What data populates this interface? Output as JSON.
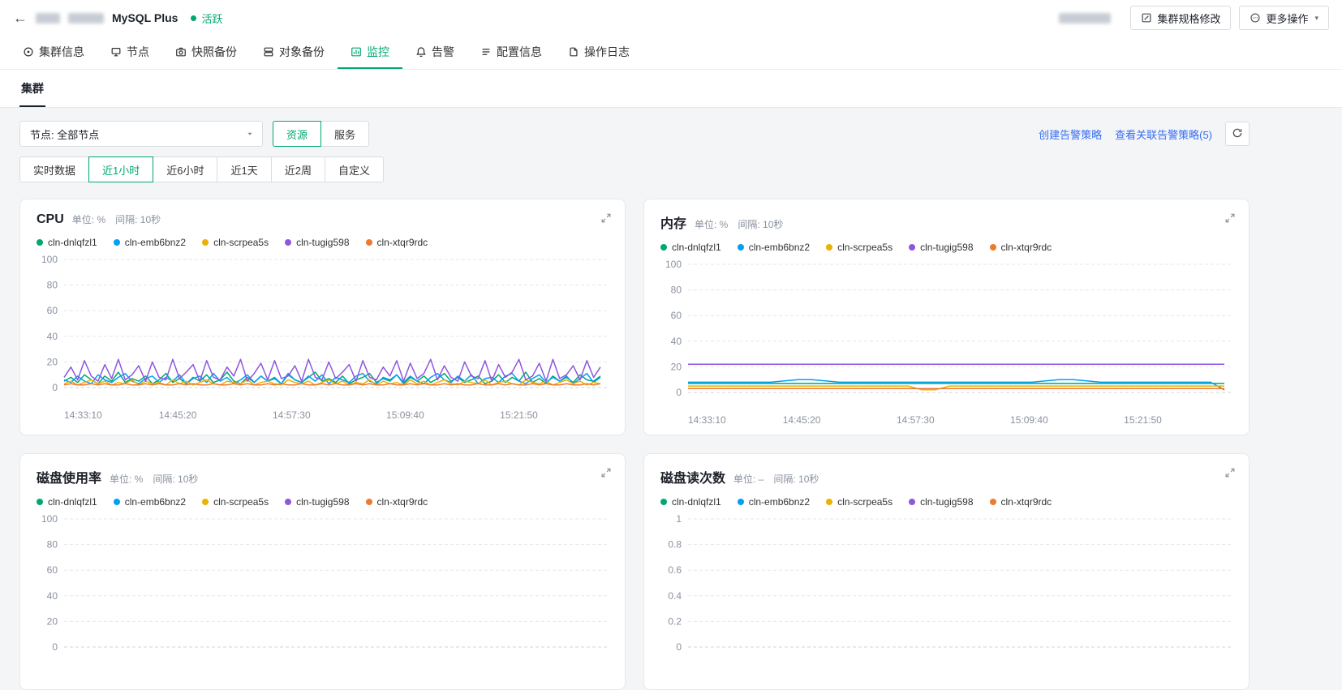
{
  "colors": {
    "accent": "#00a870",
    "link": "#366ef4"
  },
  "header": {
    "back_icon": "←",
    "product_name": "MySQL Plus",
    "status": {
      "label": "活跃",
      "color": "#00a870"
    },
    "actions": {
      "modify_spec": "集群规格修改",
      "more": "更多操作"
    }
  },
  "tabs": [
    {
      "key": "cluster-info",
      "label": "集群信息",
      "icon": "cluster-info-icon",
      "active": false
    },
    {
      "key": "nodes",
      "label": "节点",
      "icon": "node-icon",
      "active": false
    },
    {
      "key": "snapshot-backup",
      "label": "快照备份",
      "icon": "snapshot-icon",
      "active": false
    },
    {
      "key": "object-backup",
      "label": "对象备份",
      "icon": "object-backup-icon",
      "active": false
    },
    {
      "key": "monitoring",
      "label": "监控",
      "icon": "monitor-icon",
      "active": true
    },
    {
      "key": "alerts",
      "label": "告警",
      "icon": "alert-icon",
      "active": false
    },
    {
      "key": "config-info",
      "label": "配置信息",
      "icon": "config-icon",
      "active": false
    },
    {
      "key": "operation-logs",
      "label": "操作日志",
      "icon": "log-icon",
      "active": false
    }
  ],
  "subtab": {
    "label": "集群"
  },
  "filters": {
    "node_select": {
      "value": "节点: 全部节点"
    },
    "category_buttons": [
      {
        "key": "resource",
        "label": "资源",
        "active": true
      },
      {
        "key": "service",
        "label": "服务",
        "active": false
      }
    ],
    "links": [
      {
        "label": "创建告警策略"
      },
      {
        "label": "查看关联告警策略(5)"
      }
    ],
    "time_ranges": [
      {
        "key": "realtime",
        "label": "实时数据",
        "active": false
      },
      {
        "key": "last-1h",
        "label": "近1小时",
        "active": true
      },
      {
        "key": "last-6h",
        "label": "近6小时",
        "active": false
      },
      {
        "key": "last-1d",
        "label": "近1天",
        "active": false
      },
      {
        "key": "last-2w",
        "label": "近2周",
        "active": false
      },
      {
        "key": "custom",
        "label": "自定义",
        "active": false
      }
    ]
  },
  "chart_data": [
    {
      "id": "cpu",
      "type": "line",
      "title": "CPU",
      "unit_label": "单位: %　间隔: 10秒",
      "y_ticks": [
        0,
        20,
        40,
        60,
        80,
        100
      ],
      "x_labels": [
        "14:33:10",
        "14:45:20",
        "14:57:30",
        "15:09:40",
        "15:21:50"
      ],
      "series": [
        {
          "name": "cln-dnlqfzl1",
          "color": "#00a870",
          "values": [
            5,
            8,
            4,
            10,
            6,
            3,
            9,
            5,
            12,
            4,
            7,
            5,
            9,
            3,
            6,
            11,
            4,
            7,
            3,
            8,
            5,
            10,
            4,
            6,
            12,
            5,
            3,
            8,
            4,
            9,
            5,
            7,
            3,
            10,
            6,
            4,
            8,
            12,
            5,
            7,
            4,
            9,
            3,
            6,
            8,
            11,
            4,
            7,
            5,
            10,
            3,
            8,
            5,
            9,
            4,
            7,
            11,
            5,
            8,
            4,
            6,
            9,
            3,
            5,
            10,
            4,
            8,
            5,
            12,
            4,
            7,
            3,
            9,
            5,
            8,
            4,
            10,
            6,
            5,
            9
          ]
        },
        {
          "name": "cln-emb6bnz2",
          "color": "#049ff5",
          "values": [
            6,
            4,
            9,
            5,
            3,
            10,
            6,
            4,
            8,
            11,
            5,
            3,
            7,
            9,
            4,
            8,
            5,
            10,
            3,
            7,
            9,
            4,
            11,
            5,
            8,
            3,
            6,
            10,
            4,
            9,
            5,
            8,
            3,
            11,
            6,
            4,
            9,
            5,
            10,
            3,
            8,
            6,
            4,
            9,
            11,
            5,
            3,
            8,
            6,
            10,
            4,
            9,
            5,
            3,
            8,
            11,
            6,
            4,
            9,
            5,
            10,
            3,
            7,
            8,
            4,
            9,
            11,
            5,
            3,
            7,
            10,
            4,
            8,
            5,
            9,
            3,
            7,
            11,
            4,
            8
          ]
        },
        {
          "name": "cln-scrpea5s",
          "color": "#ebb105",
          "values": [
            3,
            5,
            2,
            4,
            6,
            3,
            5,
            2,
            4,
            3,
            6,
            2,
            5,
            3,
            4,
            2,
            6,
            3,
            5,
            2,
            4,
            6,
            3,
            2,
            5,
            4,
            3,
            6,
            2,
            4,
            5,
            3,
            2,
            6,
            4,
            3,
            5,
            2,
            4,
            6,
            3,
            5,
            2,
            4,
            3,
            6,
            2,
            5,
            3,
            4,
            2,
            6,
            3,
            5,
            2,
            4,
            6,
            3,
            2,
            5,
            4,
            3,
            6,
            2,
            4,
            5,
            3,
            2,
            6,
            4,
            3,
            5,
            2,
            4,
            6,
            3,
            5,
            2,
            4,
            3
          ]
        },
        {
          "name": "cln-tugig598",
          "color": "#8e56dd",
          "values": [
            8,
            16,
            6,
            21,
            9,
            5,
            18,
            7,
            22,
            6,
            10,
            17,
            5,
            20,
            8,
            6,
            22,
            7,
            12,
            18,
            5,
            21,
            8,
            6,
            16,
            9,
            22,
            5,
            11,
            19,
            6,
            21,
            7,
            9,
            17,
            5,
            22,
            8,
            6,
            20,
            7,
            12,
            18,
            5,
            21,
            8,
            6,
            16,
            9,
            21,
            5,
            19,
            7,
            11,
            22,
            6,
            17,
            8,
            5,
            20,
            9,
            7,
            21,
            5,
            18,
            8,
            12,
            22,
            6,
            9,
            19,
            5,
            22,
            7,
            10,
            17,
            6,
            21,
            8,
            16
          ]
        },
        {
          "name": "cln-xtqr9rdc",
          "color": "#ed7b2f",
          "values": [
            2,
            3,
            2,
            2,
            3,
            2,
            3,
            2,
            2,
            3,
            2,
            2,
            3,
            2,
            3,
            2,
            2,
            3,
            2,
            3,
            2,
            2,
            3,
            2,
            2,
            3,
            2,
            3,
            2,
            2,
            3,
            2,
            3,
            2,
            2,
            3,
            2,
            2,
            3,
            2,
            3,
            2,
            2,
            3,
            2,
            3,
            2,
            2,
            3,
            2,
            2,
            3,
            2,
            3,
            2,
            2,
            3,
            2,
            3,
            2,
            2,
            3,
            2,
            2,
            3,
            2,
            3,
            2,
            2,
            3,
            2,
            3,
            2,
            2,
            3,
            2,
            2,
            3,
            2,
            3
          ]
        }
      ]
    },
    {
      "id": "memory",
      "type": "line",
      "title": "内存",
      "unit_label": "单位: %　间隔: 10秒",
      "y_ticks": [
        0,
        20,
        40,
        60,
        80,
        100
      ],
      "x_labels": [
        "14:33:10",
        "14:45:20",
        "14:57:30",
        "15:09:40",
        "15:21:50"
      ],
      "series": [
        {
          "name": "cln-dnlqfzl1",
          "color": "#00a870",
          "values": [
            7,
            7,
            7,
            7,
            7,
            7,
            7,
            7,
            7,
            7,
            7,
            7,
            7,
            7,
            7,
            7,
            7,
            7,
            7,
            7,
            7,
            7,
            7,
            7,
            7,
            7,
            7,
            7,
            7,
            7,
            7,
            7,
            7,
            7,
            7,
            7,
            7,
            7,
            7,
            7
          ]
        },
        {
          "name": "cln-emb6bnz2",
          "color": "#049ff5",
          "values": [
            8,
            8,
            8,
            8,
            8,
            8,
            8,
            9,
            10,
            10,
            9,
            8,
            8,
            8,
            8,
            8,
            8,
            8,
            8,
            8,
            8,
            8,
            8,
            8,
            8,
            8,
            9,
            10,
            10,
            9,
            8,
            8,
            8,
            8,
            8,
            8,
            8,
            8,
            8,
            2
          ]
        },
        {
          "name": "cln-scrpea5s",
          "color": "#ebb105",
          "values": [
            5,
            5,
            5,
            5,
            5,
            5,
            5,
            5,
            5,
            5,
            5,
            5,
            5,
            5,
            5,
            5,
            5,
            2,
            2,
            5,
            5,
            5,
            5,
            5,
            5,
            5,
            5,
            5,
            5,
            5,
            5,
            5,
            5,
            5,
            5,
            5,
            5,
            5,
            5,
            5
          ]
        },
        {
          "name": "cln-tugig598",
          "color": "#8e56dd",
          "values": [
            22,
            22,
            22,
            22,
            22,
            22,
            22,
            22,
            22,
            22,
            22,
            22,
            22,
            22,
            22,
            22,
            22,
            22,
            22,
            22,
            22,
            22,
            22,
            22,
            22,
            22,
            22,
            22,
            22,
            22,
            22,
            22,
            22,
            22,
            22,
            22,
            22,
            22,
            22,
            22
          ]
        },
        {
          "name": "cln-xtqr9rdc",
          "color": "#ed7b2f",
          "values": [
            3,
            3,
            3,
            3,
            3,
            3,
            3,
            3,
            3,
            3,
            3,
            3,
            3,
            3,
            3,
            3,
            3,
            3,
            3,
            3,
            3,
            3,
            3,
            3,
            3,
            3,
            3,
            3,
            3,
            3,
            3,
            3,
            3,
            3,
            3,
            3,
            3,
            3,
            3,
            3
          ]
        }
      ]
    },
    {
      "id": "disk-usage",
      "type": "line",
      "title": "磁盘使用率",
      "unit_label": "单位: %　间隔: 10秒",
      "y_ticks": [
        0,
        20,
        40,
        60,
        80,
        100
      ],
      "x_labels": [],
      "series": [
        {
          "name": "cln-dnlqfzl1",
          "color": "#00a870",
          "values": []
        },
        {
          "name": "cln-emb6bnz2",
          "color": "#049ff5",
          "values": []
        },
        {
          "name": "cln-scrpea5s",
          "color": "#ebb105",
          "values": []
        },
        {
          "name": "cln-tugig598",
          "color": "#8e56dd",
          "values": []
        },
        {
          "name": "cln-xtqr9rdc",
          "color": "#ed7b2f",
          "values": []
        }
      ]
    },
    {
      "id": "disk-reads",
      "type": "line",
      "title": "磁盘读次数",
      "unit_label": "单位: –　间隔: 10秒",
      "y_ticks": [
        0,
        0.2,
        0.4,
        0.6,
        0.8,
        1
      ],
      "x_labels": [],
      "series": [
        {
          "name": "cln-dnlqfzl1",
          "color": "#00a870",
          "values": []
        },
        {
          "name": "cln-emb6bnz2",
          "color": "#049ff5",
          "values": []
        },
        {
          "name": "cln-scrpea5s",
          "color": "#ebb105",
          "values": []
        },
        {
          "name": "cln-tugig598",
          "color": "#8e56dd",
          "values": []
        },
        {
          "name": "cln-xtqr9rdc",
          "color": "#ed7b2f",
          "values": []
        }
      ]
    }
  ]
}
